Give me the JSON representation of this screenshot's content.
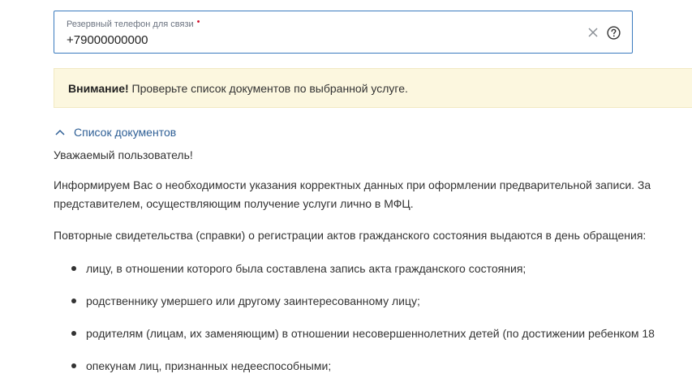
{
  "phone_field": {
    "label": "Резервный телефон для связи",
    "required_mark": "•",
    "value": "+79000000000"
  },
  "notice": {
    "strong": "Внимание!",
    "text": " Проверьте список документов по выбранной услуге."
  },
  "documents": {
    "toggle_label": "Список документов",
    "greeting": "Уважаемый пользователь!",
    "info_line_1": "Информируем Вас о необходимости указания корректных данных при оформлении предварительной записи. За",
    "info_line_2": "представителем, осуществляющим получение услуги лично в МФЦ.",
    "repeat_intro": "Повторные свидетельства (справки) о регистрации актов гражданского состояния выдаются в день обращения:",
    "items": [
      "лицу, в отношении которого была составлена запись акта гражданского состояния;",
      "родственнику умершего или другому заинтересованному лицу;",
      "родителям (лицам, их заменяющим) в отношении несовершеннолетних детей (по достижении ребенком 18",
      "опекунам лиц, признанных недееспособными;"
    ]
  },
  "colors": {
    "field_border": "#3b7bbf",
    "required": "#d2122e",
    "notice_bg": "#fcf7df",
    "link": "#2d5e95"
  },
  "icons": {
    "clear": "close-icon",
    "help": "question-circle-icon",
    "toggle": "chevron-up-icon"
  }
}
